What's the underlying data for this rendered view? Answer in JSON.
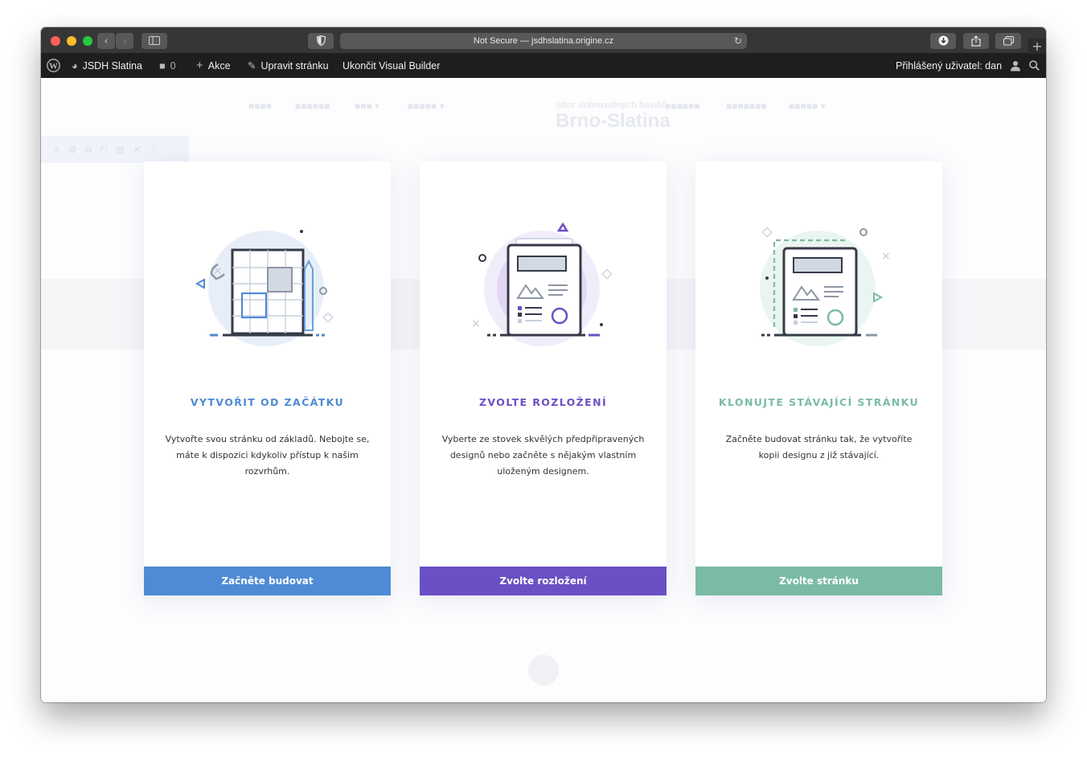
{
  "browser": {
    "address_text": "Not Secure — jsdhslatina.origine.cz",
    "reload_icon": "reload-icon"
  },
  "adminbar": {
    "site_name": "JSDH Slatina",
    "comments_count": "0",
    "new_label": "Akce",
    "edit_label": "Upravit stránku",
    "exit_label": "Ukončit Visual Builder",
    "user_label": "Přihlášený uživatel: dan"
  },
  "background": {
    "logo_line1": "Sbor dobrovolných hasičů",
    "logo_line2": "Brno-Slatina"
  },
  "cards": [
    {
      "title": "VYTVOŘIT OD ZAČÁTKU",
      "description": "Vytvořte svou stránku od základů. Nebojte se, máte k dispozici kdykoliv přístup k našim rozvrhům.",
      "button": "Začněte budovat",
      "accent": "#4f8ad4",
      "icon": "blueprint-icon"
    },
    {
      "title": "ZVOLTE ROZLOŽENÍ",
      "description": "Vyberte ze stovek skvělých předpřipravených designů nebo začněte s nějakým vlastním uloženým designem.",
      "button": "Zvolte rozložení",
      "accent": "#6b4fc4",
      "icon": "layout-pack-icon"
    },
    {
      "title": "KLONUJTE STÁVAJÍCÍ STRÁNKU",
      "description": "Začněte budovat stránku tak, že vytvoříte kopii designu z již stávající.",
      "button": "Zvolte stránku",
      "accent": "#7bbba6",
      "icon": "clone-page-icon"
    }
  ]
}
